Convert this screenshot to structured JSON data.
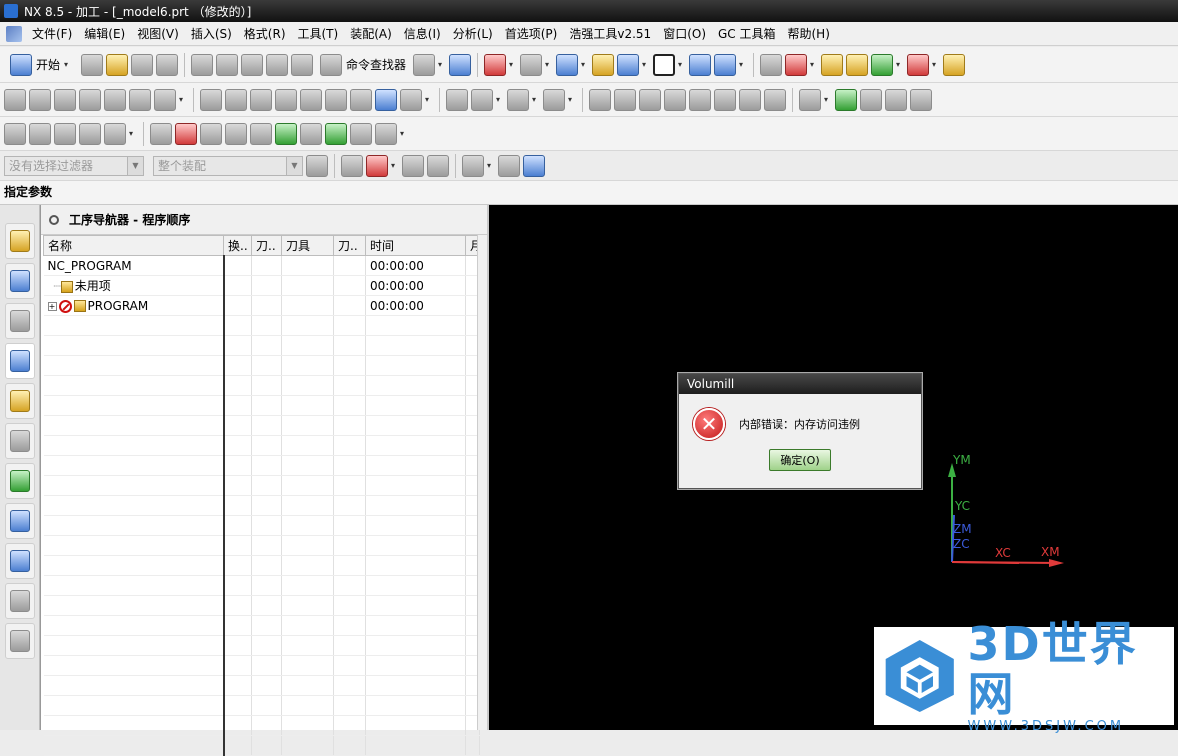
{
  "window": {
    "title": "NX 8.5 - 加工 - [_model6.prt （修改的）]"
  },
  "menu": {
    "items": [
      "文件(F)",
      "编辑(E)",
      "视图(V)",
      "插入(S)",
      "格式(R)",
      "工具(T)",
      "装配(A)",
      "信息(I)",
      "分析(L)",
      "首选项(P)",
      "浩强工具v2.51",
      "窗口(O)",
      "GC 工具箱",
      "帮助(H)"
    ]
  },
  "toolbar": {
    "start_label": "开始",
    "command_finder_label": "命令查找器"
  },
  "selection_bar": {
    "filter_placeholder": "没有选择过滤器",
    "scope_placeholder": "整个装配"
  },
  "cue_line": {
    "text": "指定参数"
  },
  "navigator": {
    "title": "工序导航器 - 程序顺序",
    "columns": [
      "名称",
      "换..",
      "刀..",
      "刀具",
      "刀..",
      "时间",
      "月"
    ],
    "rows": [
      {
        "name": "NC_PROGRAM",
        "time": "00:00:00"
      },
      {
        "name": "未用项",
        "time": "00:00:00"
      },
      {
        "name": "PROGRAM",
        "time": "00:00:00"
      }
    ]
  },
  "dialog": {
    "title": "Volumill",
    "message": "内部错误：内存访问违例",
    "ok_label": "确定(O)"
  },
  "triad": {
    "ym": "YM",
    "yc": "YC",
    "zm": "ZM",
    "zc": "ZC",
    "xc": "XC",
    "xm": "XM"
  },
  "watermark": {
    "brand": "3D世界网",
    "url": "WWW.3DSJW.COM"
  },
  "colors": {
    "viewport_bg": "#000000",
    "axis_x": "#e03a3a",
    "axis_y": "#3cb043",
    "axis_z": "#3b5bdb"
  }
}
